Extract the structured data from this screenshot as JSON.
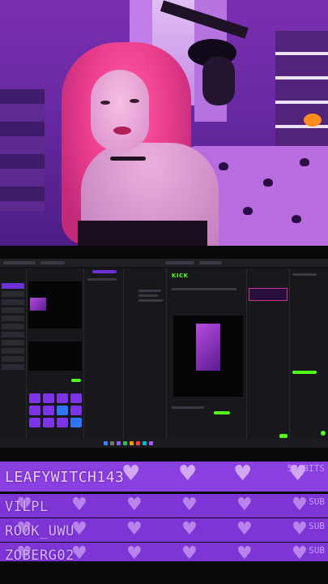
{
  "stream": {
    "platform_logo": "KICK",
    "colors": {
      "accent": "#7e35d6",
      "kick_green": "#53fc18",
      "bar_text": "#d9b5ff"
    }
  },
  "alerts": [
    {
      "name": "LEAFYWITCH143",
      "tag": "53 BITS"
    },
    {
      "name": "VILPL",
      "tag": "SUB"
    },
    {
      "name": "ROOK_UWU",
      "tag": "SUB"
    },
    {
      "name": "ZOBERG02",
      "tag": "SUB"
    }
  ],
  "icons": {
    "bar_decoration": "heart-icon",
    "microphone": "microphone-icon"
  }
}
